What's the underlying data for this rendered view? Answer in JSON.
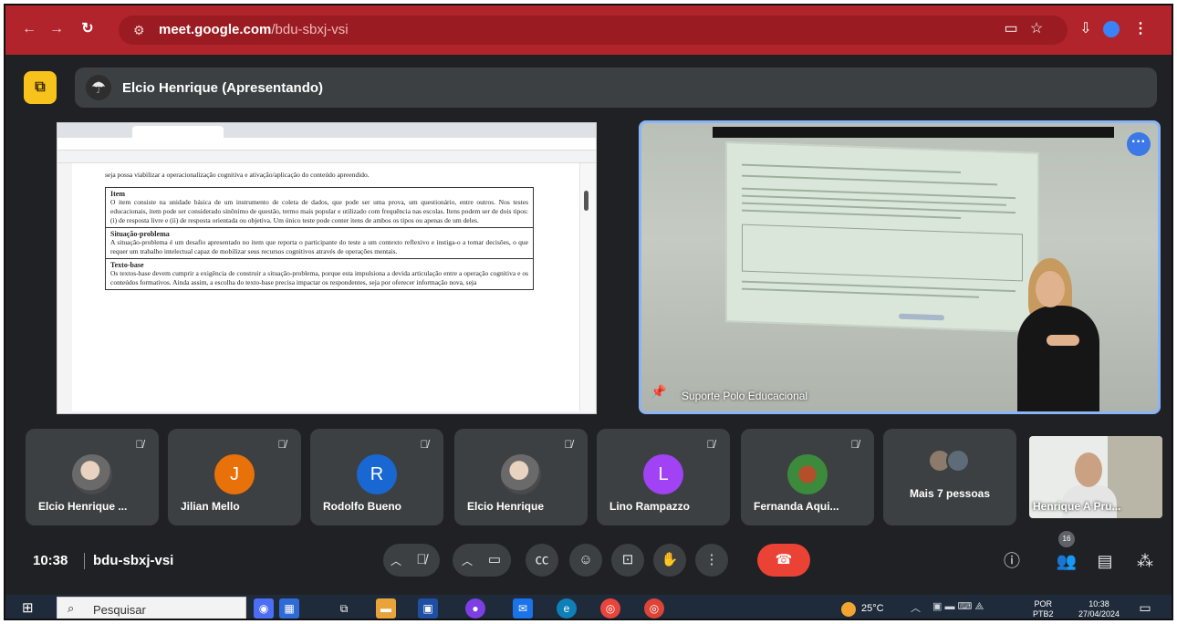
{
  "browser": {
    "url_host": "meet.google.com",
    "url_path": "/bdu-sbxj-vsi",
    "back_icon": "arrow-left-icon",
    "forward_icon": "arrow-right-icon",
    "reload_icon": "reload-icon",
    "accent": "#b2242b"
  },
  "presenter": {
    "name": "Elcio Henrique (Apresentando)"
  },
  "shared_doc": {
    "lead": "seja possa viabilizar a operacionalização cognitiva e ativação/aplicação do conteúdo apreendido.",
    "sections": [
      {
        "heading": "Item",
        "body": "O item consiste na unidade básica de um instrumento de coleta de dados, que pode ser uma prova, um questionário, entre outros. Nos testes educacionais, item pode ser considerado sinônimo de questão, termo mais popular e utilizado com frequência nas escolas. Itens podem ser de dois tipos: (i) de resposta livre e (ii) de resposta orientada ou objetiva. Um único teste pode conter itens de ambos os tipos ou apenas de um deles."
      },
      {
        "heading": "Situação-problema",
        "body": "A situação-problema é um desafio apresentado no item que reporta o participante do teste a um contexto reflexivo e instiga-o a tomar decisões, o que requer um trabalho intelectual capaz de mobilizar seus recursos cognitivos através de operações mentais."
      },
      {
        "heading": "Texto-base",
        "body": "Os textos-base devem cumprir a exigência de construir a situação-problema, porque esta impulsiona a devida articulação entre a operação cognitiva e os conteúdos formativos. Ainda assim, a escolha do texto-base precisa impactar os respondentes, seja por oferecer informação nova, seja"
      }
    ]
  },
  "pinned": {
    "name": "Suporte Polo Educacional"
  },
  "participants": [
    {
      "name": "Elcio Henrique ...",
      "initial": "",
      "color": "",
      "photo": true
    },
    {
      "name": "Jilian Mello",
      "initial": "J",
      "color": "#e8710a",
      "photo": false
    },
    {
      "name": "Rodolfo Bueno",
      "initial": "R",
      "color": "#1967d2",
      "photo": false
    },
    {
      "name": "Elcio Henrique",
      "initial": "",
      "color": "",
      "photo": true
    },
    {
      "name": "Lino Rampazzo",
      "initial": "L",
      "color": "#a142f4",
      "photo": false
    },
    {
      "name": "Fernanda Aqui...",
      "initial": "",
      "color": "#3c8a3c",
      "photo": true
    }
  ],
  "more_people": "Mais 7 pessoas",
  "self_name": "Henrique A Pru...",
  "meeting": {
    "time": "10:38",
    "code": "bdu-sbxj-vsi",
    "people_count": "16"
  },
  "taskbar": {
    "search_placeholder": "Pesquisar",
    "temperature": "25°C",
    "lang_1": "POR",
    "lang_2": "PTB2",
    "clock_time": "10:38",
    "clock_date": "27/04/2024"
  }
}
